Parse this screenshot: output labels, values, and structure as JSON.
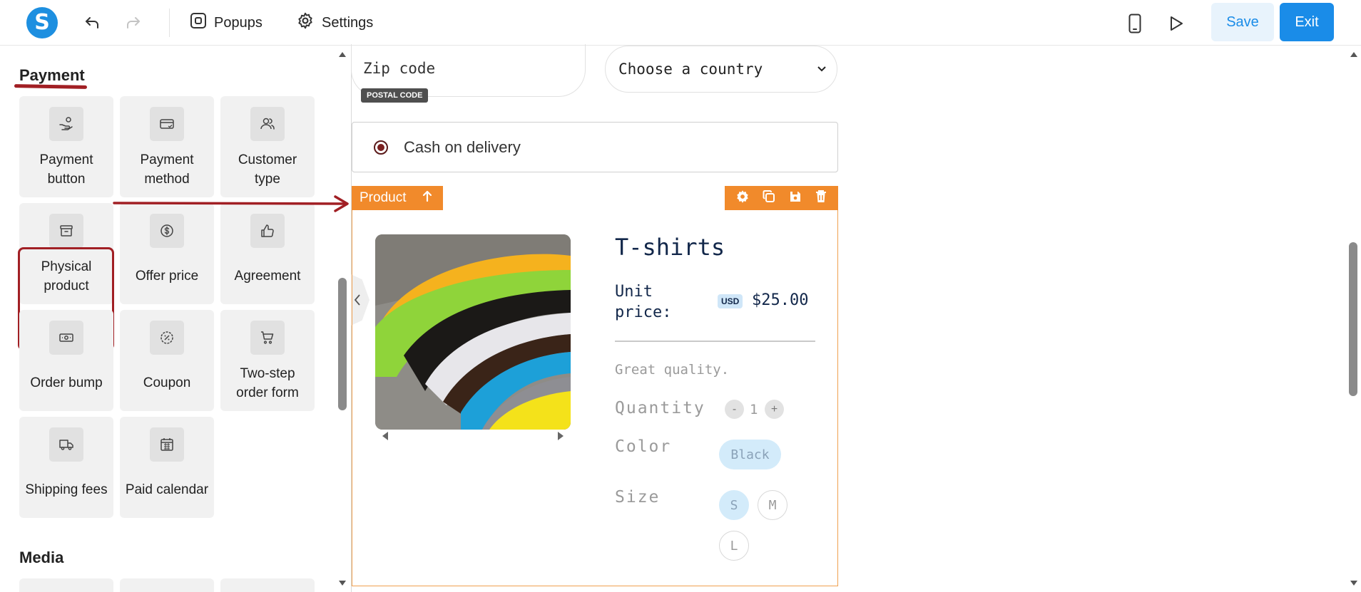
{
  "toolbar": {
    "logo_letter": "S",
    "popups_label": "Popups",
    "settings_label": "Settings",
    "save_label": "Save",
    "exit_label": "Exit"
  },
  "sidebar": {
    "payment_title": "Payment",
    "media_title": "Media",
    "tiles": [
      {
        "label": "Payment button",
        "icon": "hand-coin-icon"
      },
      {
        "label": "Payment method",
        "icon": "credit-card-icon"
      },
      {
        "label": "Customer type",
        "icon": "users-icon"
      },
      {
        "label": "Physical product",
        "icon": "archive-box-icon"
      },
      {
        "label": "Offer price",
        "icon": "dollar-circle-icon"
      },
      {
        "label": "Agreement",
        "icon": "thumbs-up-icon"
      },
      {
        "label": "Order bump",
        "icon": "banknote-icon"
      },
      {
        "label": "Coupon",
        "icon": "percent-badge-icon"
      },
      {
        "label": "Two-step order form",
        "icon": "shopping-cart-icon"
      },
      {
        "label": "Shipping fees",
        "icon": "truck-icon"
      },
      {
        "label": "Paid calendar",
        "icon": "calendar-icon"
      }
    ]
  },
  "form": {
    "zip_placeholder": "Zip code",
    "postal_badge": "POSTAL CODE",
    "country_placeholder": "Choose a country",
    "payment_option": "Cash on delivery"
  },
  "product_block": {
    "tag_label": "Product",
    "title": "T-shirts",
    "unit_price_label": "Unit price:",
    "currency": "USD",
    "price": "$25.00",
    "description": "Great quality.",
    "quantity_label": "Quantity",
    "quantity_minus": "-",
    "quantity_value": "1",
    "quantity_plus": "+",
    "color_label": "Color",
    "color_option": "Black",
    "size_label": "Size",
    "sizes": [
      "S",
      "M",
      "L"
    ],
    "selected_size": "S"
  },
  "colors": {
    "accent_blue": "#1a8ce8",
    "block_orange": "#f18a2b",
    "annotation_red": "#a11f24"
  }
}
